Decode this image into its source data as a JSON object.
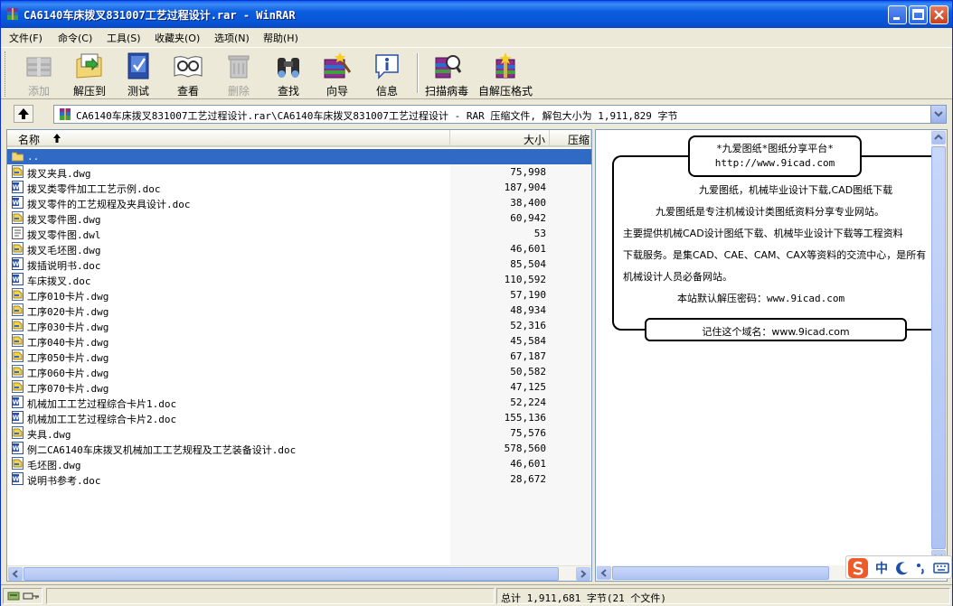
{
  "window": {
    "title": "CA6140车床拨叉831007工艺过程设计.rar - WinRAR"
  },
  "menu": [
    "文件(F)",
    "命令(C)",
    "工具(S)",
    "收藏夹(O)",
    "选项(N)",
    "帮助(H)"
  ],
  "toolbar": [
    {
      "label": "添加",
      "icon": "add-icon",
      "disabled": true
    },
    {
      "label": "解压到",
      "icon": "extract-icon",
      "disabled": false
    },
    {
      "label": "测试",
      "icon": "test-icon",
      "disabled": false
    },
    {
      "label": "查看",
      "icon": "view-icon",
      "disabled": false
    },
    {
      "label": "删除",
      "icon": "delete-icon",
      "disabled": true
    },
    {
      "label": "查找",
      "icon": "find-icon",
      "disabled": false
    },
    {
      "label": "向导",
      "icon": "wizard-icon",
      "disabled": false
    },
    {
      "label": "信息",
      "icon": "info-icon",
      "disabled": false
    },
    {
      "label": "扫描病毒",
      "icon": "virus-scan-icon",
      "disabled": false
    },
    {
      "label": "自解压格式",
      "icon": "sfx-icon",
      "disabled": false
    }
  ],
  "address": {
    "text": "CA6140车床拨叉831007工艺过程设计.rar\\CA6140车床拨叉831007工艺过程设计 - RAR 压缩文件, 解包大小为 1,911,829 字节"
  },
  "columns": {
    "name": "名称",
    "size": "大小",
    "packed": "压缩"
  },
  "files": [
    {
      "name": "..",
      "size": "",
      "type": "folder",
      "selected": true
    },
    {
      "name": "拨叉夹具.dwg",
      "size": "75,998",
      "type": "dwg"
    },
    {
      "name": "拨叉类零件加工工艺示例.doc",
      "size": "187,904",
      "type": "doc"
    },
    {
      "name": "拨叉零件的工艺规程及夹具设计.doc",
      "size": "38,400",
      "type": "doc"
    },
    {
      "name": "拨叉零件图.dwg",
      "size": "60,942",
      "type": "dwg"
    },
    {
      "name": "拨叉零件图.dwl",
      "size": "53",
      "type": "dwl"
    },
    {
      "name": "拨叉毛坯图.dwg",
      "size": "46,601",
      "type": "dwg"
    },
    {
      "name": "拨插说明书.doc",
      "size": "85,504",
      "type": "doc"
    },
    {
      "name": "车床拨叉.doc",
      "size": "110,592",
      "type": "doc"
    },
    {
      "name": "工序010卡片.dwg",
      "size": "57,190",
      "type": "dwg"
    },
    {
      "name": "工序020卡片.dwg",
      "size": "48,934",
      "type": "dwg"
    },
    {
      "name": "工序030卡片.dwg",
      "size": "52,316",
      "type": "dwg"
    },
    {
      "name": "工序040卡片.dwg",
      "size": "45,584",
      "type": "dwg"
    },
    {
      "name": "工序050卡片.dwg",
      "size": "67,187",
      "type": "dwg"
    },
    {
      "name": "工序060卡片.dwg",
      "size": "50,582",
      "type": "dwg"
    },
    {
      "name": "工序070卡片.dwg",
      "size": "47,125",
      "type": "dwg"
    },
    {
      "name": "机械加工工艺过程综合卡片1.doc",
      "size": "52,224",
      "type": "doc"
    },
    {
      "name": "机械加工工艺过程综合卡片2.doc",
      "size": "155,136",
      "type": "doc"
    },
    {
      "name": "夹具.dwg",
      "size": "75,576",
      "type": "dwg"
    },
    {
      "name": "例二CA6140车床拨叉机械加工工艺规程及工艺装备设计.doc",
      "size": "578,560",
      "type": "doc"
    },
    {
      "name": "毛坯图.dwg",
      "size": "46,601",
      "type": "dwg"
    },
    {
      "name": "说明书参考.doc",
      "size": "28,672",
      "type": "doc"
    }
  ],
  "comment": {
    "title": "*九爱图纸*图纸分享平台*",
    "url": "http://www.9icad.com",
    "lines": [
      "九爱图纸，机械毕业设计下载,CAD图纸下载",
      "九爱图纸是专注机械设计类图纸资料分享专业网站。",
      "主要提供机械CAD设计图纸下载、机械毕业设计下载等工程资料",
      "下载服务。是集CAD、CAE、CAM、CAX等资料的交流中心，是所有",
      "机械设计人员必备网站。",
      "本站默认解压密码：www.9icad.com"
    ],
    "footer": "记住这个域名：www.9icad.com"
  },
  "status": {
    "total": "总计 1,911,681 字节(21 个文件)"
  },
  "ime": {
    "label": "中"
  }
}
